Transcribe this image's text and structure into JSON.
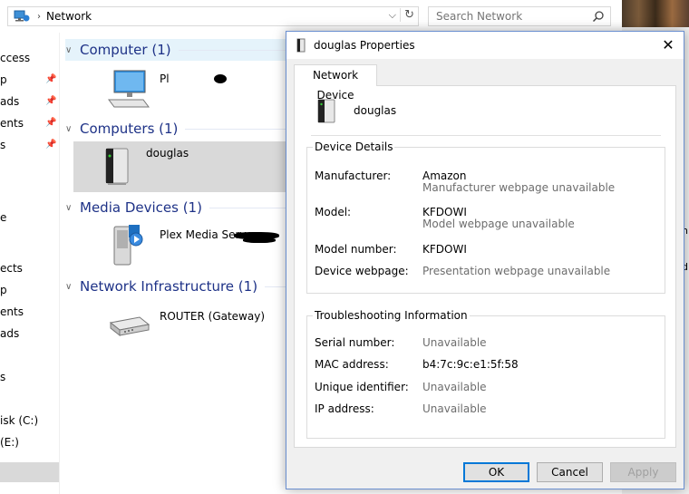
{
  "explorer": {
    "address_path": "Network",
    "search_placeholder": "Search Network",
    "nav_items": [
      {
        "label": "ccess",
        "pinned": false
      },
      {
        "label": "p",
        "pinned": true
      },
      {
        "label": "ads",
        "pinned": true
      },
      {
        "label": "ents",
        "pinned": true
      },
      {
        "label": "s",
        "pinned": true
      },
      {
        "label": "e",
        "pinned": false
      },
      {
        "label": "ects",
        "pinned": false
      },
      {
        "label": "p",
        "pinned": false
      },
      {
        "label": "ents",
        "pinned": false
      },
      {
        "label": "ads",
        "pinned": false
      },
      {
        "label": "s",
        "pinned": false
      },
      {
        "label": "isk (C:)",
        "pinned": false
      },
      {
        "label": "(E:)",
        "pinned": false
      }
    ],
    "groups": [
      {
        "title": "Computer (1)",
        "devices": [
          {
            "name": "Pl"
          }
        ]
      },
      {
        "title": "Computers (1)",
        "devices": [
          {
            "name": "douglas"
          }
        ]
      },
      {
        "title": "Media Devices (1)",
        "devices": [
          {
            "name": "Plex Media Server"
          }
        ]
      },
      {
        "title": "Network Infrastructure (1)",
        "devices": [
          {
            "name": "ROUTER (Gateway)"
          }
        ]
      }
    ]
  },
  "desktop_fragments": [
    "n",
    "d"
  ],
  "dialog": {
    "title": "douglas Properties",
    "close_glyph": "✕",
    "tab_label": "Network Device",
    "device_name": "douglas",
    "device_details": {
      "legend": "Device Details",
      "manufacturer_label": "Manufacturer:",
      "manufacturer_value": "Amazon",
      "manufacturer_sub": "Manufacturer webpage unavailable",
      "model_label": "Model:",
      "model_value": "KFDOWI",
      "model_sub": "Model webpage unavailable",
      "model_number_label": "Model number:",
      "model_number_value": "KFDOWI",
      "webpage_label": "Device webpage:",
      "webpage_value": "Presentation webpage unavailable"
    },
    "troubleshooting": {
      "legend": "Troubleshooting Information",
      "serial_label": "Serial number:",
      "serial_value": "Unavailable",
      "mac_label": "MAC address:",
      "mac_value": "b4:7c:9c:e1:5f:58",
      "uid_label": "Unique identifier:",
      "uid_value": "Unavailable",
      "ip_label": "IP address:",
      "ip_value": "Unavailable"
    },
    "buttons": {
      "ok": "OK",
      "cancel": "Cancel",
      "apply": "Apply"
    }
  },
  "colors": {
    "group_title": "#1e3287",
    "accent": "#0078d7",
    "selection": "#d9d9d9"
  }
}
